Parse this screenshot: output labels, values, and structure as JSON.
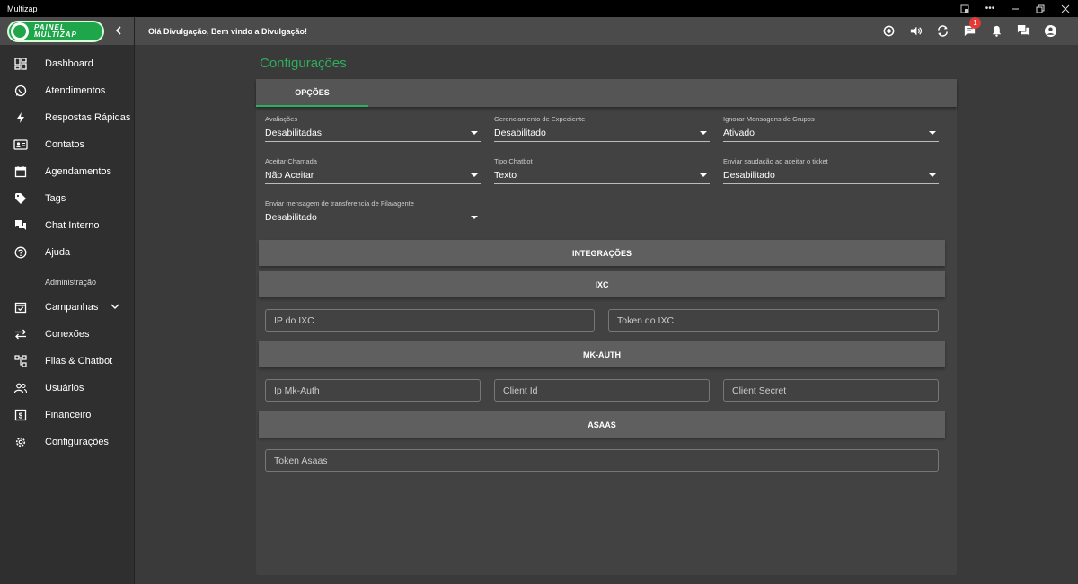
{
  "window": {
    "title": "Multizap"
  },
  "logo": {
    "text_line1": "PAINEL",
    "text_line2": "MULTIZAP"
  },
  "header": {
    "greeting": "Olá Divulgação, Bem vindo a Divulgação!",
    "chat_badge": "1"
  },
  "sidebar": {
    "items": [
      {
        "label": "Dashboard",
        "icon": "dashboard-icon"
      },
      {
        "label": "Atendimentos",
        "icon": "whatsapp-icon"
      },
      {
        "label": "Respostas Rápidas",
        "icon": "bolt-icon"
      },
      {
        "label": "Contatos",
        "icon": "contact-card-icon"
      },
      {
        "label": "Agendamentos",
        "icon": "calendar-icon"
      },
      {
        "label": "Tags",
        "icon": "tag-icon"
      },
      {
        "label": "Chat Interno",
        "icon": "forum-icon"
      },
      {
        "label": "Ajuda",
        "icon": "help-icon"
      }
    ],
    "admin_label": "Administração",
    "admin_items": [
      {
        "label": "Campanhas",
        "icon": "event-available-icon"
      },
      {
        "label": "Conexões",
        "icon": "sync-alt-icon"
      },
      {
        "label": "Filas & Chatbot",
        "icon": "account-tree-icon"
      },
      {
        "label": "Usuários",
        "icon": "people-icon"
      },
      {
        "label": "Financeiro",
        "icon": "money-icon"
      },
      {
        "label": "Configurações",
        "icon": "settings-icon"
      }
    ]
  },
  "page": {
    "title": "Configurações",
    "tab_label": "OPÇÕES",
    "selects": [
      {
        "label": "Avaliações",
        "value": "Desabilitadas"
      },
      {
        "label": "Gerenciamento de Expediente",
        "value": "Desabilitado"
      },
      {
        "label": "Ignorar Mensagens de Grupos",
        "value": "Ativado"
      },
      {
        "label": "Aceitar Chamada",
        "value": "Não Aceitar"
      },
      {
        "label": "Tipo Chatbot",
        "value": "Texto"
      },
      {
        "label": "Enviar saudação ao aceitar o ticket",
        "value": "Desabilitado"
      },
      {
        "label": "Enviar mensagem de transferencia de Fila/agente",
        "value": "Desabilitado"
      }
    ],
    "integrations_label": "INTEGRAÇÕES",
    "ixc": {
      "label": "IXC",
      "ip_placeholder": "IP do IXC",
      "token_placeholder": "Token do IXC"
    },
    "mkauth": {
      "label": "MK-AUTH",
      "ip_placeholder": "Ip Mk-Auth",
      "client_id_placeholder": "Client Id",
      "client_secret_placeholder": "Client Secret"
    },
    "asaas": {
      "label": "ASAAS",
      "token_placeholder": "Token Asaas"
    }
  },
  "colors": {
    "accent": "#2eaf5c",
    "badge": "#e53935"
  }
}
